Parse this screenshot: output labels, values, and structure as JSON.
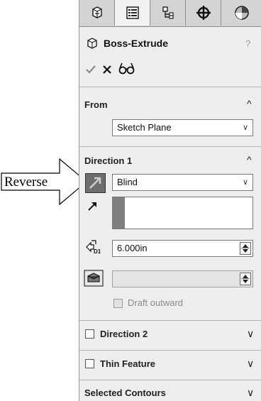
{
  "annotation": {
    "label": "Reverse"
  },
  "tabs": [
    {
      "icon": "feature-manager-icon",
      "active": false
    },
    {
      "icon": "property-manager-icon",
      "active": true
    },
    {
      "icon": "configuration-manager-icon",
      "active": false
    },
    {
      "icon": "dimxpert-manager-icon",
      "active": false
    },
    {
      "icon": "display-manager-icon",
      "active": false
    }
  ],
  "header": {
    "title": "Boss-Extrude",
    "help": "?",
    "ok_icon": "checkmark-icon",
    "cancel_icon": "close-icon",
    "preview_icon": "detailed-preview-icon"
  },
  "from": {
    "title": "From",
    "start_condition": "Sketch Plane"
  },
  "direction1": {
    "title": "Direction 1",
    "end_condition": "Blind",
    "depth": "6.000in",
    "draft_label": "Draft outward"
  },
  "direction2": {
    "title": "Direction 2"
  },
  "thin_feature": {
    "title": "Thin Feature"
  },
  "selected_contours": {
    "title": "Selected Contours"
  },
  "colors": {
    "panel_bg": "#eeeeee",
    "tab_bg": "#d6d6d6",
    "reverse_button_bg": "#6e6e6e",
    "direction_swatch": "#7f7f7f"
  }
}
